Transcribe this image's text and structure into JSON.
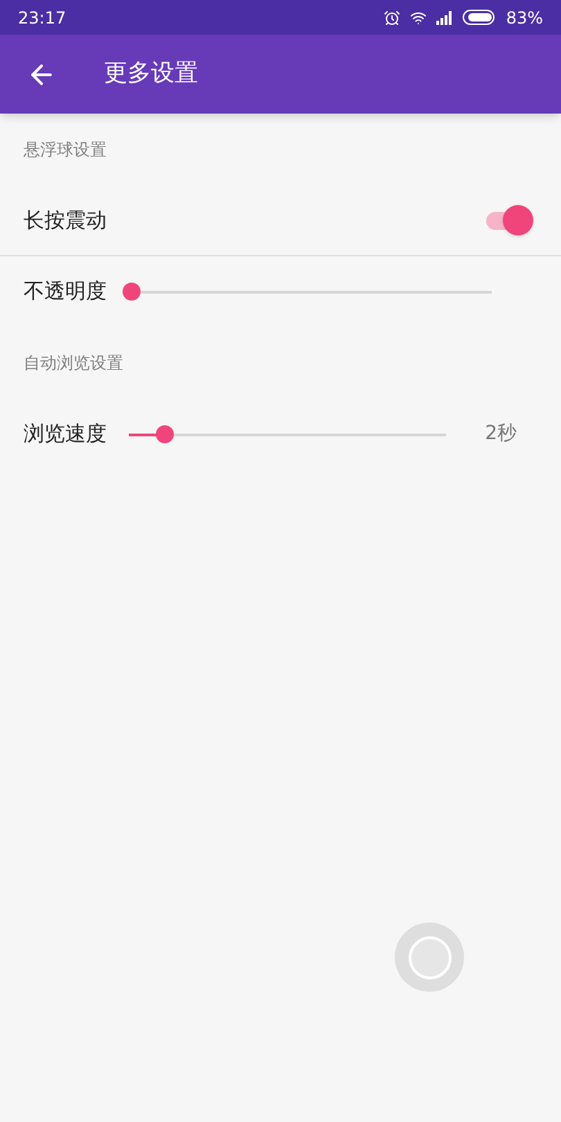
{
  "status_bar": {
    "time": "23:17",
    "battery": "83%"
  },
  "app_bar": {
    "title": "更多设置"
  },
  "sections": [
    {
      "header": "悬浮球设置",
      "items": [
        {
          "kind": "switch",
          "label": "长按震动",
          "on": true
        },
        {
          "kind": "slider",
          "label": "不透明度",
          "level": 0
        }
      ]
    },
    {
      "header": "自动浏览设置",
      "items": [
        {
          "kind": "slider",
          "label": "浏览速度",
          "level": 0.11,
          "reading": "2秒"
        }
      ]
    }
  ],
  "floating_ball": {
    "shown": true
  }
}
